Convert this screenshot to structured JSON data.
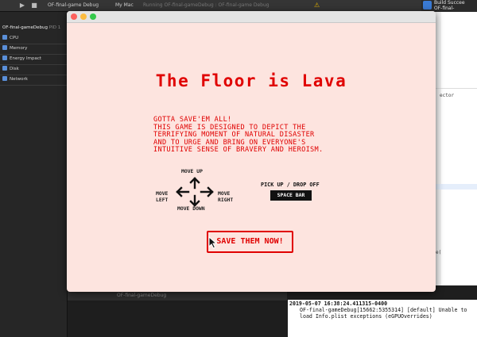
{
  "xcode": {
    "scheme": "OF-final-game Debug",
    "device": "My Mac",
    "status": "Running OF-final-gameDebug : OF-final-game Debug",
    "build_title": "Build Succee",
    "build_subtitle": "OF-final-gameDebu",
    "navigator": {
      "process": "OF-final-gameDebug",
      "pid": "PID 1",
      "items": [
        "CPU",
        "Memory",
        "Energy Impact",
        "Disk",
        "Network"
      ]
    },
    "editor_fragments": [
      "ector",
      "e("
    ],
    "debug_target": "OF-final-gameDebug",
    "console": {
      "line1": "2019-05-07 16:38:24.411315-0400",
      "line2": "OF-final-gameDebug[15662:5355314] [default] Unable to",
      "line3": "load Info.plist exceptions (eGPUOverrides)"
    }
  },
  "game": {
    "window_title": "",
    "title": "The Floor is Lava",
    "intro": "Gotta save'em all!\nThis game is designed to depict the\nterrifying moment of natural disaster\nand to urge and bring on everyone's\nintuitive sense of bravery and heroism.",
    "controls": {
      "up": "Move up",
      "down": "Move down",
      "left_1": "Move",
      "left_2": "Left",
      "right_1": "Move",
      "right_2": "Right",
      "pickup": "Pick up / drop off",
      "space": "Space bar"
    },
    "start_button": "Save them now!"
  },
  "colors": {
    "game_bg": "#fde4df",
    "accent_red": "#e00000"
  }
}
